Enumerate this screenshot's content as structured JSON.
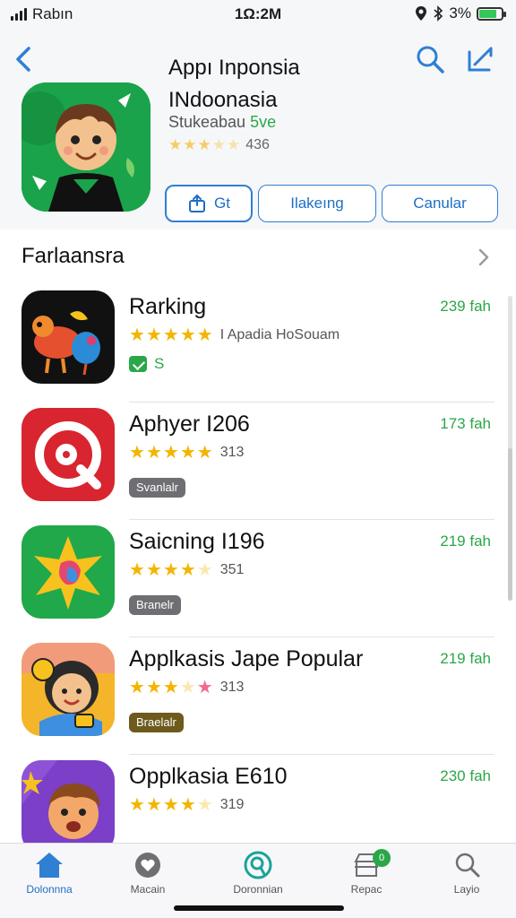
{
  "status_bar": {
    "carrier": "Rabın",
    "time": "1Ω:2M",
    "battery": "3%"
  },
  "header": {
    "title": "Appı Inponsia INdoonasia",
    "subtitle_main": "Stukeabau",
    "subtitle_accent": "5ve",
    "rating_count": "436",
    "buttons": {
      "get": "Gt",
      "ranking": "Ilakeıng",
      "calendar": "Canular"
    }
  },
  "section": {
    "title": "Farlaansra"
  },
  "apps": [
    {
      "name": "Rarking",
      "rating_text": "I Apadia HoSouam",
      "meta": "239 fah",
      "price": "S",
      "badge": ""
    },
    {
      "name": "Aphyer I206",
      "rating_text": "313",
      "meta": "173 fah",
      "price": "",
      "badge": "Svanlalr"
    },
    {
      "name": "Saicning I196",
      "rating_text": "351",
      "meta": "219 fah",
      "price": "",
      "badge": "Branelr"
    },
    {
      "name": "Applkasis Jape Popular",
      "rating_text": "313",
      "meta": "219 fah",
      "price": "",
      "badge": "Braelalr"
    },
    {
      "name": "Opplkasia E610",
      "rating_text": "319",
      "meta": "230 fah",
      "price": "",
      "badge": ""
    }
  ],
  "tabbar": {
    "items": [
      {
        "label": "Dolonnna",
        "icon": "home-icon"
      },
      {
        "label": "Macain",
        "icon": "heart-icon"
      },
      {
        "label": "Doronnian",
        "icon": "search-circle-icon"
      },
      {
        "label": "Repac",
        "icon": "store-icon",
        "badge": "0"
      },
      {
        "label": "Layio",
        "icon": "search-icon"
      }
    ]
  }
}
